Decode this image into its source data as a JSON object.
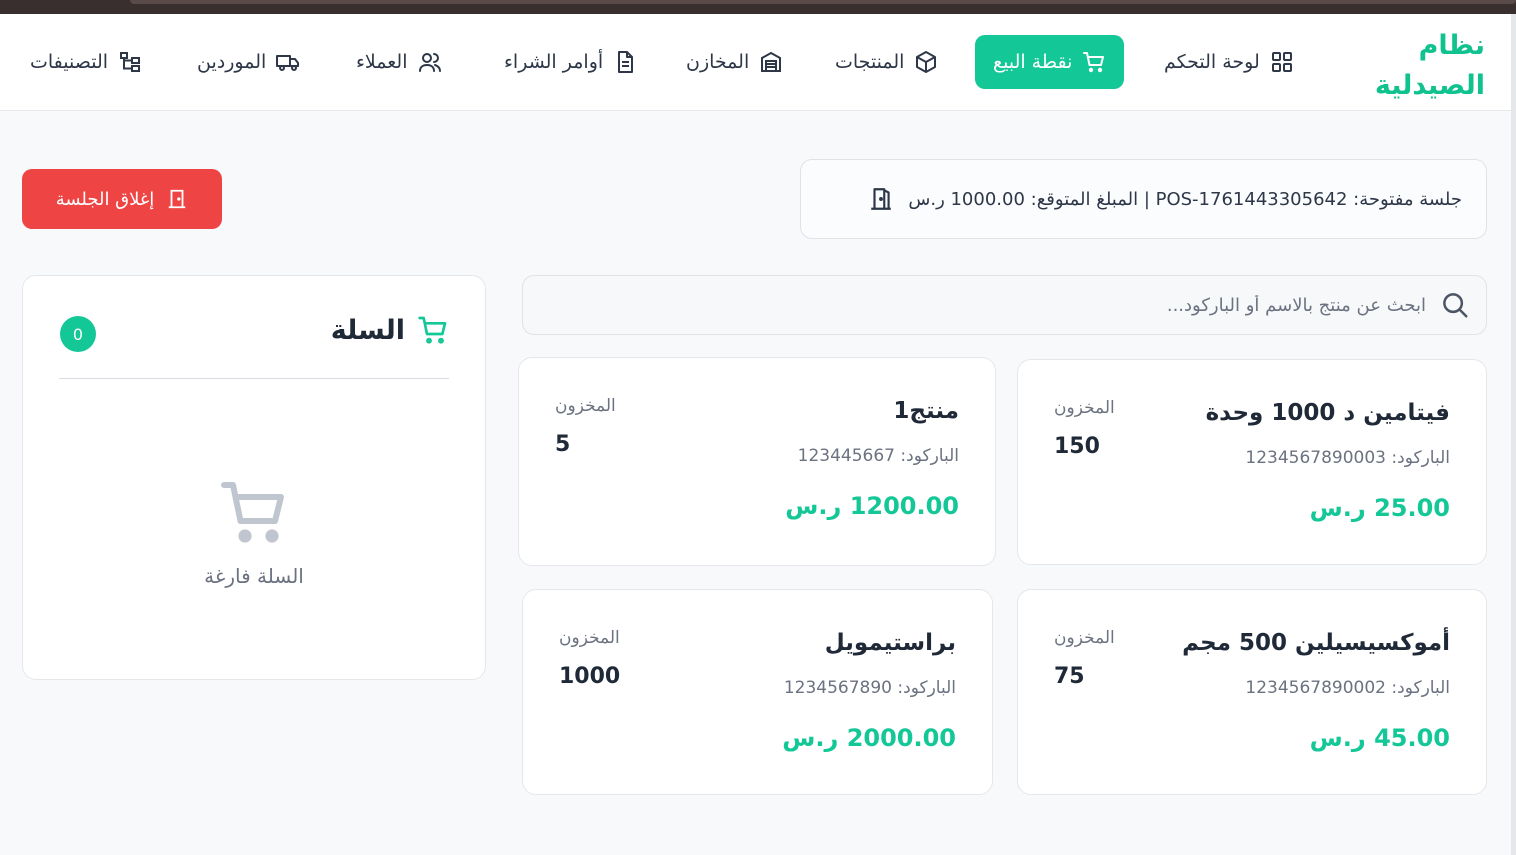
{
  "brand": {
    "line1": "نظام",
    "line2": "الصيدلية"
  },
  "nav": [
    {
      "label": "لوحة التحكم",
      "icon": "grid-icon"
    },
    {
      "label": "نقطة البيع",
      "icon": "cart-icon",
      "active": true
    },
    {
      "label": "المنتجات",
      "icon": "box-icon"
    },
    {
      "label": "المخازن",
      "icon": "warehouse-icon"
    },
    {
      "label": "أوامر الشراء",
      "icon": "document-icon"
    },
    {
      "label": "العملاء",
      "icon": "users-icon"
    },
    {
      "label": "الموردين",
      "icon": "truck-icon"
    },
    {
      "label": "التصنيفات",
      "icon": "tree-icon"
    }
  ],
  "session": {
    "text": "جلسة مفتوحة: POS-1761443305642 | المبلغ المتوقع: 1000.00 ر.س",
    "close_label": "إغلاق الجلسة"
  },
  "search": {
    "placeholder": "ابحث عن منتج بالاسم أو الباركود..."
  },
  "products": [
    {
      "name": "فيتامين د 1000 وحدة",
      "barcode": "الباركود: 1234567890003",
      "price": "25.00 ر.س",
      "stock_label": "المخزون",
      "stock": "150"
    },
    {
      "name": "منتج1",
      "barcode": "الباركود: 123445667",
      "price": "1200.00 ر.س",
      "stock_label": "المخزون",
      "stock": "5"
    },
    {
      "name": "أموكسيسيلين 500 مجم",
      "barcode": "الباركود: 1234567890002",
      "price": "45.00 ر.س",
      "stock_label": "المخزون",
      "stock": "75"
    },
    {
      "name": "براستيمويل",
      "barcode": "الباركود: 1234567890",
      "price": "2000.00 ر.س",
      "stock_label": "المخزون",
      "stock": "1000"
    }
  ],
  "cart": {
    "title": "السلة",
    "count": "0",
    "empty_text": "السلة فارغة"
  },
  "colors": {
    "accent": "#14c797",
    "danger": "#ef4444"
  }
}
